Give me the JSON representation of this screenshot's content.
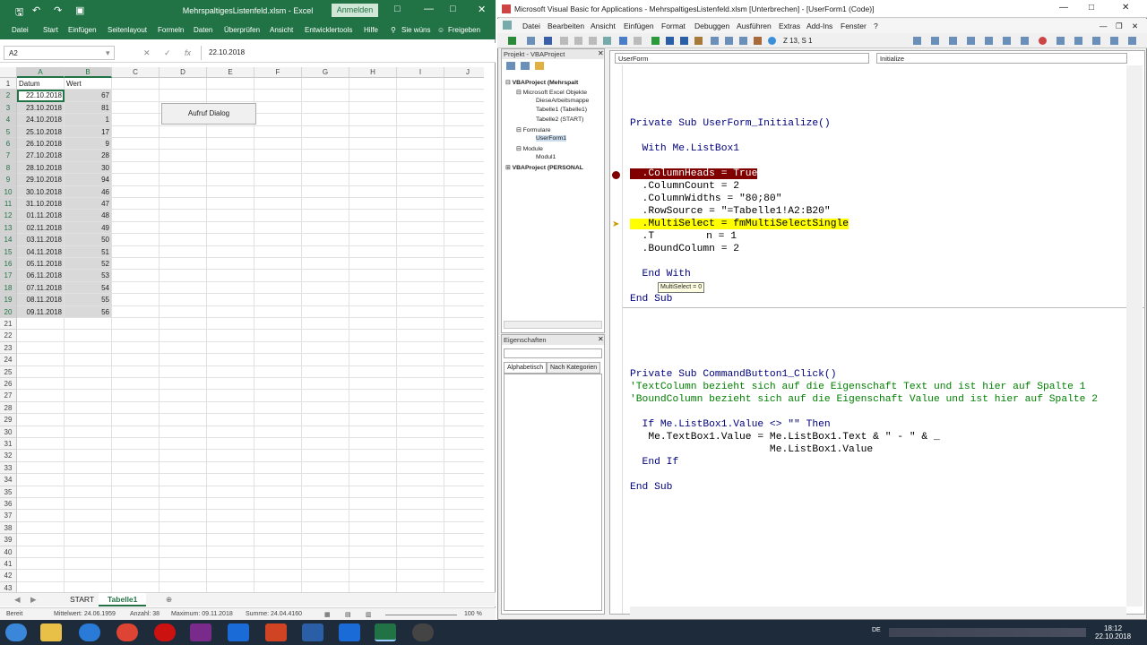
{
  "excel": {
    "title": "MehrspaltigesListenfeld.xlsm  -  Excel",
    "anmelden": "Anmelden",
    "ribbon_tabs": [
      "Datei",
      "Start",
      "Einfügen",
      "Seitenlayout",
      "Formeln",
      "Daten",
      "Überprüfen",
      "Ansicht",
      "Entwicklertools",
      "Hilfe",
      "Sie wüns",
      "Freigeben"
    ],
    "name_box": "A2",
    "formula_value": "22.10.2018",
    "columns": [
      "A",
      "B",
      "C",
      "D",
      "E",
      "F",
      "G",
      "H",
      "I",
      "J"
    ],
    "headers": {
      "a": "Datum",
      "b": "Wert"
    },
    "rows": [
      [
        "22.10.2018",
        "67"
      ],
      [
        "23.10.2018",
        "81"
      ],
      [
        "24.10.2018",
        "1"
      ],
      [
        "25.10.2018",
        "17"
      ],
      [
        "26.10.2018",
        "9"
      ],
      [
        "27.10.2018",
        "28"
      ],
      [
        "28.10.2018",
        "30"
      ],
      [
        "29.10.2018",
        "94"
      ],
      [
        "30.10.2018",
        "46"
      ],
      [
        "31.10.2018",
        "47"
      ],
      [
        "01.11.2018",
        "48"
      ],
      [
        "02.11.2018",
        "49"
      ],
      [
        "03.11.2018",
        "50"
      ],
      [
        "04.11.2018",
        "51"
      ],
      [
        "05.11.2018",
        "52"
      ],
      [
        "06.11.2018",
        "53"
      ],
      [
        "07.11.2018",
        "54"
      ],
      [
        "08.11.2018",
        "55"
      ],
      [
        "09.11.2018",
        "56"
      ]
    ],
    "row_numbers": [
      "1",
      "2",
      "3",
      "4",
      "5",
      "6",
      "7",
      "8",
      "9",
      "10",
      "11",
      "12",
      "13",
      "14",
      "15",
      "16",
      "17",
      "18",
      "19",
      "20",
      "21",
      "22",
      "23",
      "24",
      "25",
      "26",
      "27",
      "28",
      "29",
      "30",
      "31",
      "32",
      "33",
      "34",
      "35",
      "36",
      "37",
      "38",
      "39",
      "40",
      "41",
      "42",
      "43"
    ],
    "button_label": "Aufruf Dialog",
    "sheet_tabs": [
      "START",
      "Tabelle1"
    ],
    "status": {
      "mode": "Bereit",
      "avg": "Mittelwert: 24.06.1959",
      "count": "Anzahl: 38",
      "max": "Maximum: 09.11.2018",
      "sum": "Summe: 24.04.4160",
      "zoom": "100 %"
    }
  },
  "vba": {
    "title": "Microsoft Visual Basic for Applications - MehrspaltigesListenfeld.xlsm [Unterbrechen] - [UserForm1 (Code)]",
    "menu": [
      "Datei",
      "Bearbeiten",
      "Ansicht",
      "Einfügen",
      "Format",
      "Debuggen",
      "Ausführen",
      "Extras",
      "Add-Ins",
      "Fenster",
      "?"
    ],
    "position": "Z 13, S 1",
    "project_title": "Projekt - VBAProject",
    "tree": [
      {
        "label": "VBAProject (Mehrspalt",
        "bold": true
      },
      {
        "label": "Microsoft Excel Objekte",
        "bold": false
      },
      {
        "label": "DieseArbeitsmappe",
        "bold": false
      },
      {
        "label": "Tabelle1 (Tabelle1)",
        "bold": false
      },
      {
        "label": "Tabelle2 (START)",
        "bold": false
      },
      {
        "label": "Formulare",
        "bold": false
      },
      {
        "label": "UserForm1",
        "bold": false
      },
      {
        "label": "Module",
        "bold": false
      },
      {
        "label": "Modul1",
        "bold": false
      },
      {
        "label": "VBAProject (PERSONAL",
        "bold": true
      }
    ],
    "properties_title": "Eigenschaften",
    "prop_tabs": [
      "Alphabetisch",
      "Nach Kategorien"
    ],
    "object_dropdown": "UserForm",
    "proc_dropdown": "Initialize",
    "tooltip": "MultiSelect = 0",
    "code": {
      "l1": "Private Sub UserForm_Initialize()",
      "l2": "  With Me.ListBox1",
      "l3": "  .ColumnHeads = True",
      "l4": "  .ColumnCount = 2",
      "l5": "  .ColumnWidths = \"80;80\"",
      "l6": "  .RowSource = \"=Tabelle1!A2:B20\"",
      "l7": "  .MultiSelect = fmMultiSelectSingle",
      "l8a": "  .T",
      "l8b": "n = 1",
      "l9": "  .BoundColumn = 2",
      "l10": "  End With",
      "l11": "End Sub",
      "l12": "Private Sub CommandButton1_Click()",
      "l13": "'TextColumn bezieht sich auf die Eigenschaft Text und ist hier auf Spalte 1",
      "l14": "'BoundColumn bezieht sich auf die Eigenschaft Value und ist hier auf Spalte 2",
      "l15": "  If Me.ListBox1.Value <> \"\" Then",
      "l16": "   Me.TextBox1.Value = Me.ListBox1.Text & \" - \" & _",
      "l17": "                       Me.ListBox1.Value",
      "l18": "  End If",
      "l19": "End Sub"
    }
  },
  "taskbar": {
    "lang": "DE",
    "time": "18:12",
    "date": "22.10.2018"
  },
  "colors": {
    "excel_green": "#217346",
    "breakpoint": "#800000",
    "exec_highlight": "#ffff00",
    "comment": "#008000"
  }
}
